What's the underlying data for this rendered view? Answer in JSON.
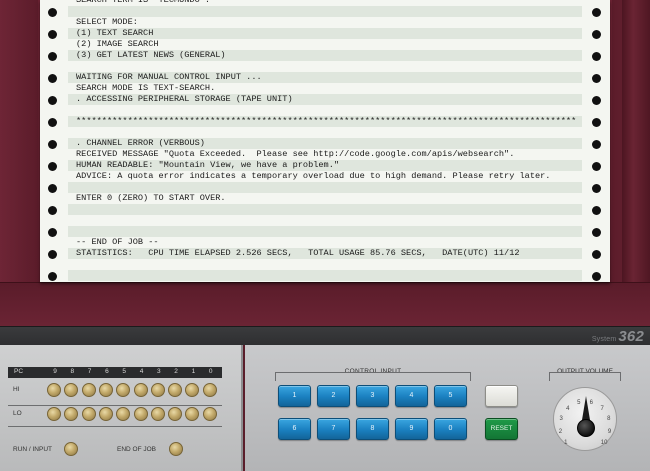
{
  "printout": {
    "lines": [
      "SEARCH TERM IS \"TECMUNDO\".",
      "",
      "SELECT MODE:",
      "(1) TEXT SEARCH",
      "(2) IMAGE SEARCH",
      "(3) GET LATEST NEWS (GENERAL)",
      "",
      "WAITING FOR MANUAL CONTROL INPUT ...",
      "SEARCH MODE IS TEXT-SEARCH.",
      ". ACCESSING PERIPHERAL STORAGE (TAPE UNIT)",
      "",
      "*************************************************************************************************",
      "",
      ". CHANNEL ERROR (VERBOUS)",
      "RECEIVED MESSAGE \"Quota Exceeded.  Please see http://code.google.com/apis/websearch\".",
      "HUMAN READABLE: \"Mountain View, we have a problem.\"",
      "ADVICE: A quota error indicates a temporary overload due to high demand. Please retry later.",
      "",
      "ENTER 0 (ZERO) TO START OVER.",
      "",
      "",
      "",
      "-- END OF JOB --",
      "STATISTICS:   CPU TIME ELAPSED 2.526 SECS,   TOTAL USAGE 85.76 SECS,   DATE(UTC) 11/12"
    ]
  },
  "brand": {
    "prefix": "System",
    "model": "362"
  },
  "lamp_panel": {
    "pc_label": "PC",
    "bits": [
      "9",
      "8",
      "7",
      "6",
      "5",
      "4",
      "3",
      "2",
      "1",
      "0"
    ],
    "hi_label": "HI",
    "lo_label": "LO",
    "run_input_label": "RUN / INPUT",
    "end_of_job_label": "END OF JOB"
  },
  "control_input": {
    "label": "CONTROL INPUT",
    "keys_row1": [
      "1",
      "2",
      "3",
      "4",
      "5"
    ],
    "keys_row2": [
      "6",
      "7",
      "8",
      "9",
      "0"
    ],
    "reset_label": "RESET"
  },
  "output_volume": {
    "label": "OUTPUT VOLUME",
    "ticks": [
      "1",
      "2",
      "3",
      "4",
      "5",
      "6",
      "7",
      "8",
      "9",
      "10"
    ],
    "level": 0.35
  },
  "colors": {
    "housing": "#621f2e",
    "paper": "#f4f6f1",
    "paper_band": "#dfe6dd",
    "key_blue": "#1a7fbf",
    "reset_green": "#137535",
    "lamp_amber": "#c2a96a"
  }
}
